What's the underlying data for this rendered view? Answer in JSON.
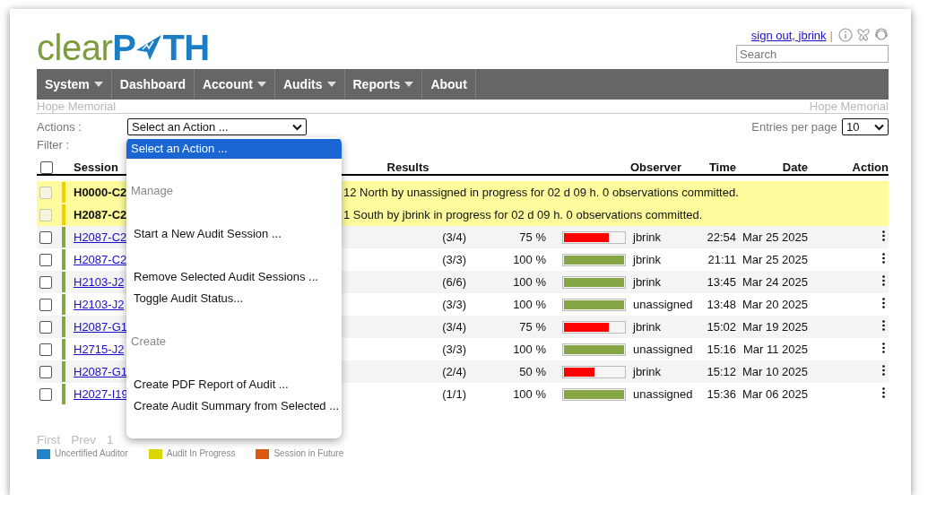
{
  "logo": {
    "first": "clear",
    "second": "P",
    "third": "TH"
  },
  "account": {
    "sign_out": "sign out, jbrink",
    "separator": "|"
  },
  "search": {
    "placeholder": "Search"
  },
  "nav": [
    {
      "label": "System",
      "has_menu": true
    },
    {
      "label": "Dashboard",
      "has_menu": false
    },
    {
      "label": "Account",
      "has_menu": true
    },
    {
      "label": "Audits",
      "has_menu": true
    },
    {
      "label": "Reports",
      "has_menu": true
    },
    {
      "label": "About",
      "has_menu": false
    }
  ],
  "facility_left": "Hope Memorial",
  "facility_right": "Hope Memorial",
  "actions_label": "Actions :",
  "actions_select": {
    "value": "Select an Action ..."
  },
  "entries_label": "Entries per page",
  "entries_select": {
    "value": "10"
  },
  "filter_label": "Filter :",
  "action_menu": [
    {
      "kind": "option",
      "label": "Select an Action ...",
      "selected": true
    },
    {
      "kind": "blank"
    },
    {
      "kind": "group",
      "label": "Manage"
    },
    {
      "kind": "blank"
    },
    {
      "kind": "option",
      "label": "Start a New Audit Session ...",
      "selected": false
    },
    {
      "kind": "blank"
    },
    {
      "kind": "option",
      "label": "Remove Selected Audit Sessions ...",
      "selected": false
    },
    {
      "kind": "option",
      "label": "Toggle Audit Status...",
      "selected": false
    },
    {
      "kind": "blank"
    },
    {
      "kind": "group",
      "label": "Create"
    },
    {
      "kind": "blank"
    },
    {
      "kind": "option",
      "label": "Create PDF Report of Audit ...",
      "selected": false
    },
    {
      "kind": "option",
      "label": "Create Audit Summary from Selected ...",
      "selected": false
    },
    {
      "kind": "blank"
    }
  ],
  "table": {
    "select_all_checked": false,
    "columns": [
      "Session",
      "Results",
      "Observer",
      "Time",
      "Date",
      "Action"
    ],
    "rows": [
      {
        "kind": "in_progress",
        "disabled": true,
        "session": "H0000-C2",
        "message": "12 North by unassigned in progress for 02 d 09 h. 0 observations committed."
      },
      {
        "kind": "in_progress",
        "disabled": true,
        "session": "H2087-C2",
        "message": "1 South by jbrink in progress for 02 d 09 h. 0 observations committed."
      },
      {
        "kind": "complete",
        "checked": false,
        "session": "H2087-C2",
        "results": "(3/4)",
        "percent": "75 %",
        "level": 0.75,
        "observer": "jbrink",
        "time": "22:54",
        "date": "Mar 25 2025"
      },
      {
        "kind": "complete",
        "checked": false,
        "session": "H2087-C2",
        "results": "(3/3)",
        "percent": "100 %",
        "level": 1,
        "observer": "jbrink",
        "time": "21:11",
        "date": "Mar 25 2025"
      },
      {
        "kind": "complete",
        "checked": false,
        "session": "H2103-J2",
        "results": "(6/6)",
        "percent": "100 %",
        "level": 1,
        "observer": "jbrink",
        "time": "13:45",
        "date": "Mar 24 2025"
      },
      {
        "kind": "complete",
        "checked": false,
        "session": "H2103-J2",
        "results": "(3/3)",
        "percent": "100 %",
        "level": 1,
        "observer": "unassigned",
        "time": "13:48",
        "date": "Mar 20 2025"
      },
      {
        "kind": "complete",
        "checked": false,
        "session": "H2087-G1",
        "results": "(3/4)",
        "percent": "75 %",
        "level": 0.75,
        "observer": "jbrink",
        "time": "15:02",
        "date": "Mar 19 2025"
      },
      {
        "kind": "complete",
        "checked": false,
        "session": "H2715-J2",
        "results": "(3/3)",
        "percent": "100 %",
        "level": 1,
        "observer": "unassigned",
        "time": "15:16",
        "date": "Mar 11 2025"
      },
      {
        "kind": "complete",
        "checked": false,
        "session": "H2087-G1",
        "results": "(2/4)",
        "percent": "50 %",
        "level": 0.5,
        "observer": "jbrink",
        "time": "15:12",
        "date": "Mar 10 2025"
      },
      {
        "kind": "complete",
        "checked": false,
        "session": "H2027-I19",
        "results": "(1/1)",
        "percent": "100 %",
        "level": 1,
        "observer": "unassigned",
        "time": "15:36",
        "date": "Mar 06 2025"
      }
    ]
  },
  "pagination": [
    {
      "label": "First"
    },
    {
      "label": "Prev"
    },
    {
      "label": "1"
    }
  ],
  "legend": [
    {
      "label": "Uncertified Auditor",
      "color": "#2385c8"
    },
    {
      "label": "Audit In Progress",
      "color": "#d9d600"
    },
    {
      "label": "Session in Future",
      "color": "#d95a10"
    }
  ]
}
